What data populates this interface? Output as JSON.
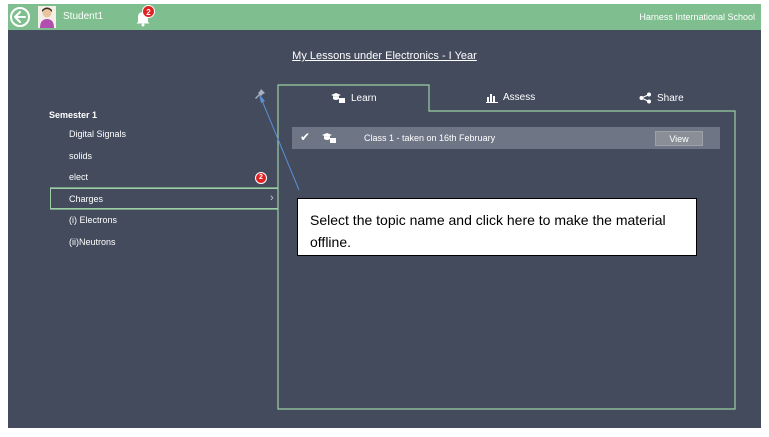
{
  "header": {
    "username": "Student1",
    "notification_count": "2",
    "school_name": "Harness International School"
  },
  "page": {
    "title": "My Lessons under Electronics - I Year"
  },
  "sidebar": {
    "semester_label": "Semester 1",
    "topics": [
      {
        "label": "Digital Signals"
      },
      {
        "label": "solids"
      },
      {
        "label": "elect",
        "badge": "2"
      },
      {
        "label": "Charges",
        "selected": true
      },
      {
        "label": "(i) Electrons"
      },
      {
        "label": "(ii)Neutrons"
      }
    ]
  },
  "tabs": [
    {
      "label": "Learn",
      "icon": "learn-icon",
      "active": true
    },
    {
      "label": "Assess",
      "icon": "bar-chart-icon"
    },
    {
      "label": "Share",
      "icon": "share-icon"
    }
  ],
  "lessons": [
    {
      "text": "Class 1 - taken on 16th February",
      "view_label": "View",
      "completed": true
    }
  ],
  "callout": {
    "text": "Select the topic name and click here to make the material offline."
  },
  "colors": {
    "topbar": "#7fbf8f",
    "background": "#434b5d",
    "panel_border": "#9ccfa6",
    "lesson_row": "#6e7585",
    "badge": "#e02222",
    "arrow": "#5b8fd4"
  }
}
